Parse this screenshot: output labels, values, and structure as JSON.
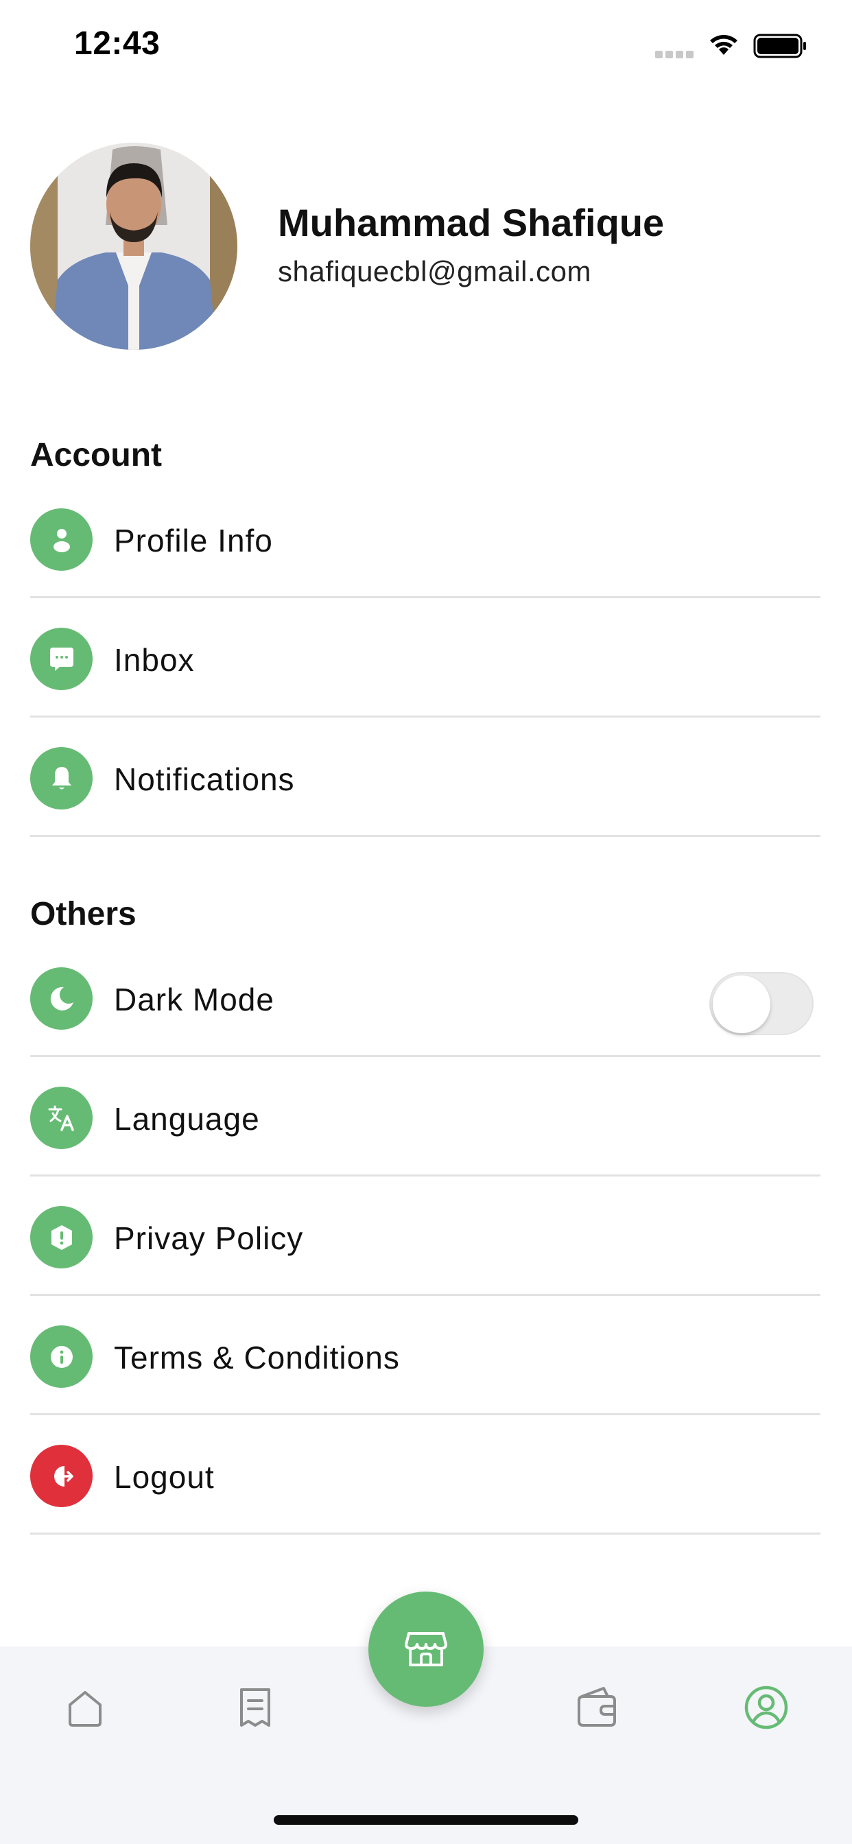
{
  "status_bar": {
    "time": "12:43"
  },
  "profile": {
    "name": "Muhammad Shafique",
    "email": "shafiquecbl@gmail.com"
  },
  "sections": {
    "account": {
      "title": "Account",
      "items": [
        {
          "label": "Profile Info",
          "icon": "user-icon"
        },
        {
          "label": "Inbox",
          "icon": "chat-icon"
        },
        {
          "label": "Notifications",
          "icon": "bell-icon"
        }
      ]
    },
    "others": {
      "title": "Others",
      "items": [
        {
          "label": "Dark Mode",
          "icon": "moon-icon",
          "toggle": false
        },
        {
          "label": "Language",
          "icon": "translate-icon"
        },
        {
          "label": "Privay Policy",
          "icon": "shield-alert-icon"
        },
        {
          "label": "Terms & Conditions",
          "icon": "info-icon"
        },
        {
          "label": "Logout",
          "icon": "logout-icon"
        }
      ]
    }
  },
  "bottom_nav": {
    "items": [
      {
        "icon": "home-icon",
        "active": false
      },
      {
        "icon": "receipt-icon",
        "active": false
      },
      {
        "icon": "store-icon",
        "active": false,
        "center": true
      },
      {
        "icon": "wallet-icon",
        "active": false
      },
      {
        "icon": "profile-icon",
        "active": true
      }
    ]
  },
  "colors": {
    "accent": "#66bb74",
    "danger": "#e0303c",
    "divider": "#e2e2e2",
    "nav_background": "#f4f5f9",
    "nav_icon_inactive": "#8c8c8c"
  }
}
